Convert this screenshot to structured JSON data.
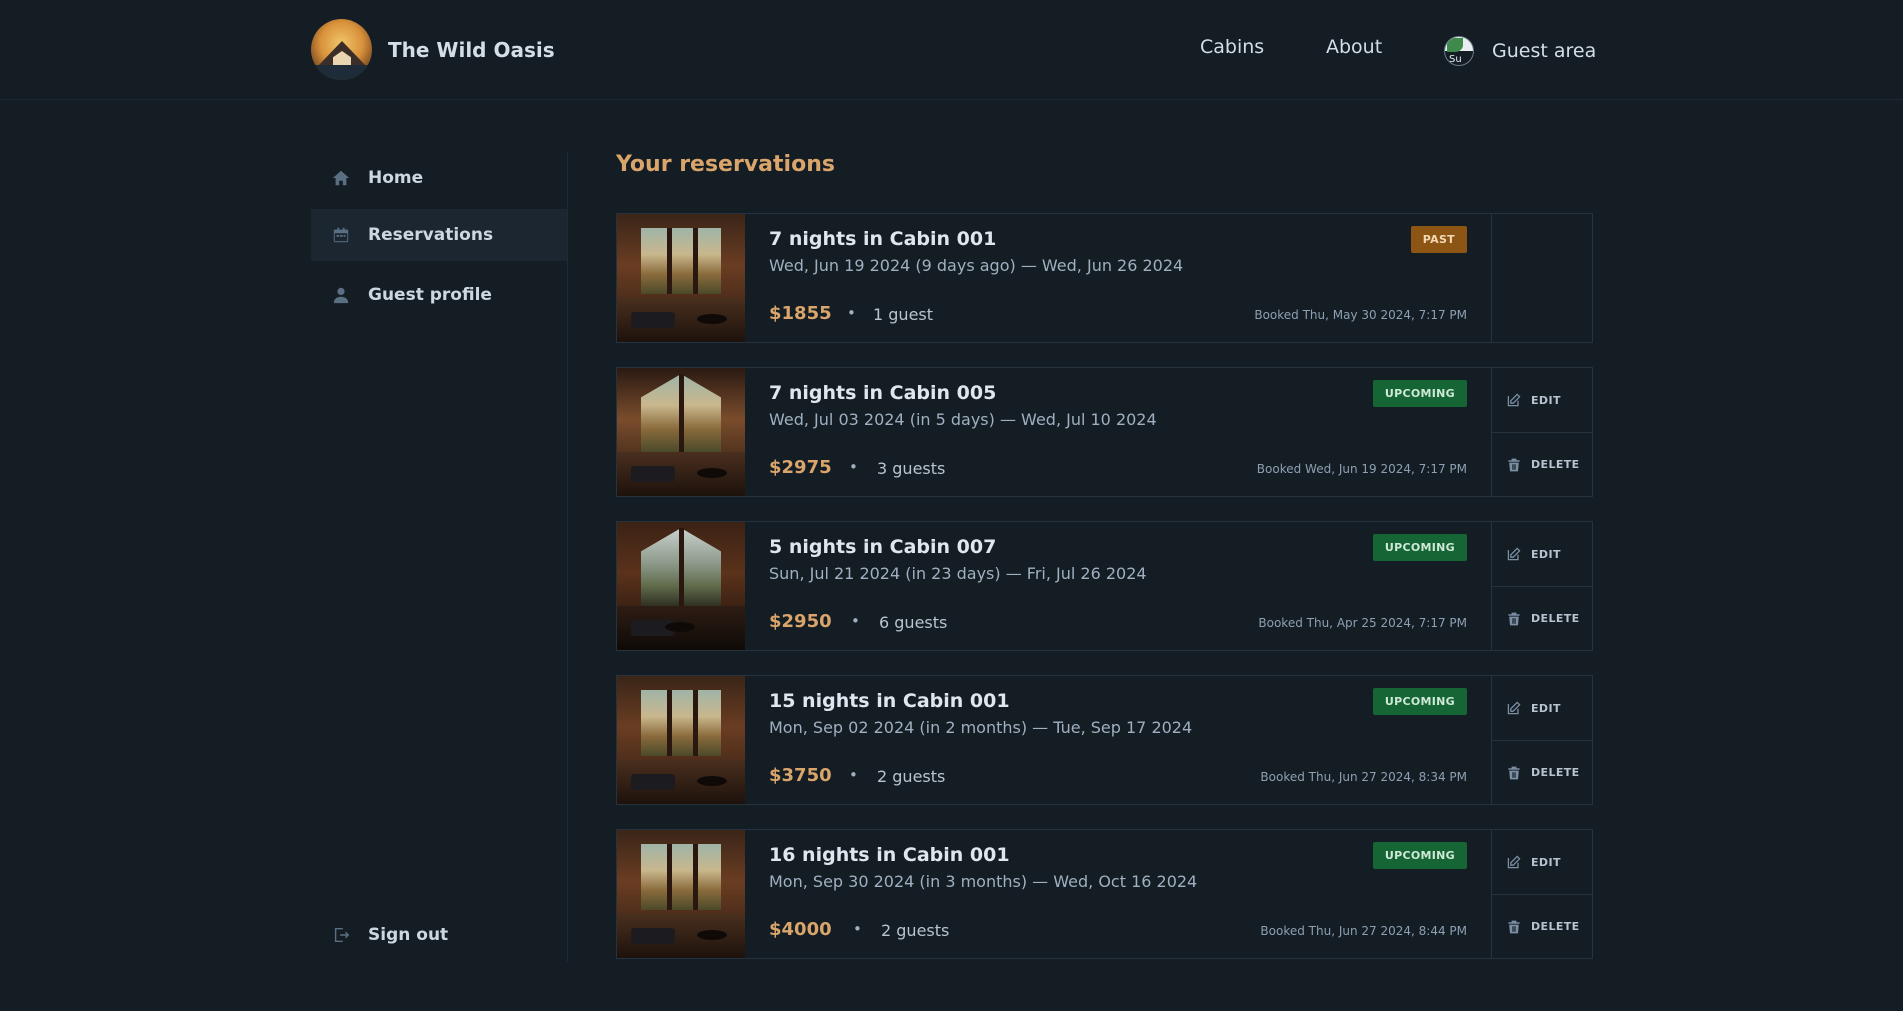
{
  "header": {
    "logo_text": "The Wild Oasis",
    "nav": {
      "cabins": "Cabins",
      "about": "About",
      "guest_area": "Guest area"
    },
    "avatar_alt": "Su"
  },
  "sidebar": {
    "items": [
      {
        "label": "Home",
        "icon": "home-icon"
      },
      {
        "label": "Reservations",
        "icon": "calendar-icon",
        "active": true
      },
      {
        "label": "Guest profile",
        "icon": "user-icon"
      }
    ],
    "sign_out": "Sign out"
  },
  "main": {
    "title": "Your reservations",
    "reservations": [
      {
        "title": "7 nights in Cabin 001",
        "dates": "Wed, Jun 19 2024 (9 days ago) — Wed, Jun 26 2024",
        "price": "$1855",
        "guests": "1 guest",
        "booked": "Booked Thu, May 30 2024, 7:17 PM",
        "status": "PAST"
      },
      {
        "title": "7 nights in Cabin 005",
        "dates": "Wed, Jul 03 2024 (in 5 days) — Wed, Jul 10 2024",
        "price": "$2975",
        "guests": "3 guests",
        "booked": "Booked Wed, Jun 19 2024, 7:17 PM",
        "status": "UPCOMING"
      },
      {
        "title": "5 nights in Cabin 007",
        "dates": "Sun, Jul 21 2024 (in 23 days) — Fri, Jul 26 2024",
        "price": "$2950",
        "guests": "6 guests",
        "booked": "Booked Thu, Apr 25 2024, 7:17 PM",
        "status": "UPCOMING"
      },
      {
        "title": "15 nights in Cabin 001",
        "dates": "Mon, Sep 02 2024 (in 2 months) — Tue, Sep 17 2024",
        "price": "$3750",
        "guests": "2 guests",
        "booked": "Booked Thu, Jun 27 2024, 8:34 PM",
        "status": "UPCOMING"
      },
      {
        "title": "16 nights in Cabin 001",
        "dates": "Mon, Sep 30 2024 (in 3 months) — Wed, Oct 16 2024",
        "price": "$4000",
        "guests": "2 guests",
        "booked": "Booked Thu, Jun 27 2024, 8:44 PM",
        "status": "UPCOMING"
      }
    ],
    "actions": {
      "edit": "EDIT",
      "delete": "DELETE"
    },
    "separator": "•"
  },
  "colors": {
    "background": "#141c24",
    "accent": "#d9a56a",
    "past_badge": "#8d5513",
    "upcoming_badge": "#166534"
  }
}
